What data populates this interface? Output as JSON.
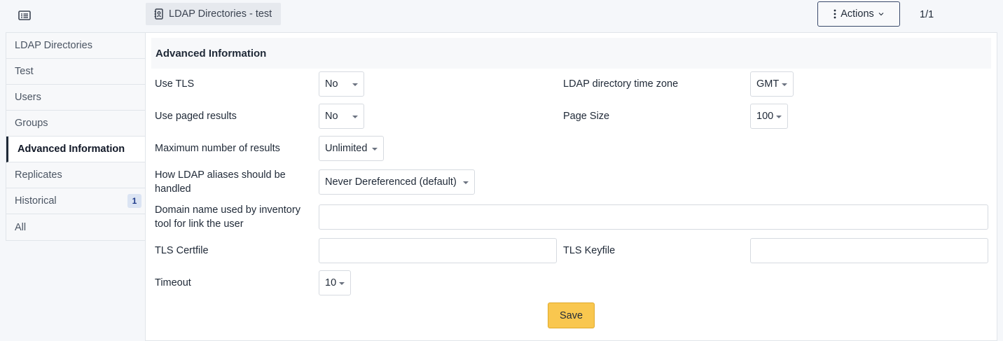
{
  "header": {
    "list_icon": "list-icon",
    "breadcrumb_icon": "address-book-icon",
    "breadcrumb_label": "LDAP Directories - test",
    "actions_label": "Actions",
    "actions_icon": "kebab-icon",
    "pager": "1/1"
  },
  "sidebar": {
    "items": [
      {
        "label": "LDAP Directories"
      },
      {
        "label": "Test"
      },
      {
        "label": "Users"
      },
      {
        "label": "Groups"
      },
      {
        "label": "Advanced Information",
        "active": true
      },
      {
        "label": "Replicates"
      },
      {
        "label": "Historical",
        "badge": "1"
      },
      {
        "label": "All"
      }
    ]
  },
  "form": {
    "section_title": "Advanced Information",
    "use_tls": {
      "label": "Use TLS",
      "value": "No"
    },
    "time_zone": {
      "label": "LDAP directory time zone",
      "value": "GMT"
    },
    "paged_results": {
      "label": "Use paged results",
      "value": "No"
    },
    "page_size": {
      "label": "Page Size",
      "value": "100"
    },
    "max_results": {
      "label": "Maximum number of results",
      "value": "Unlimited"
    },
    "aliases": {
      "label_line1": "How LDAP aliases should be",
      "label_line2": "handled",
      "value": "Never Dereferenced (default)"
    },
    "domain_name": {
      "label_line1": "Domain name used by inventory",
      "label_line2": "tool for link the user",
      "value": ""
    },
    "tls_certfile": {
      "label": "TLS Certfile",
      "value": ""
    },
    "tls_keyfile": {
      "label": "TLS Keyfile",
      "value": ""
    },
    "timeout": {
      "label": "Timeout",
      "value": "10"
    },
    "save_label": "Save"
  }
}
